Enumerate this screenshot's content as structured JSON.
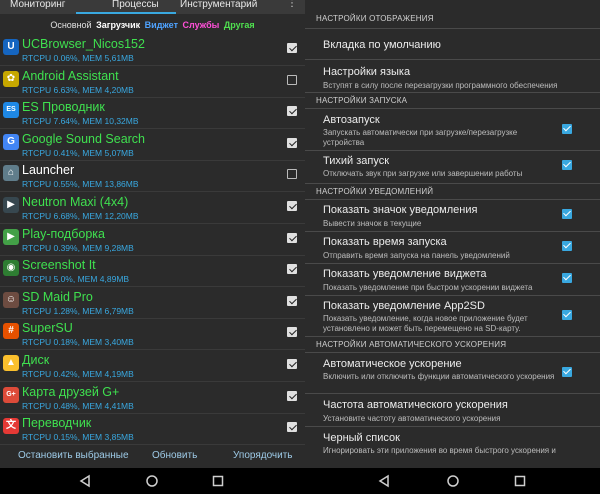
{
  "left": {
    "tabs": [
      "Мониторинг",
      "Процессы",
      "Инструментарий"
    ],
    "filters": [
      {
        "label": "Основной",
        "color": "#e0e0e0"
      },
      {
        "label": "Загрузчик",
        "color": "#ffffff"
      },
      {
        "label": "Виджет",
        "color": "#4fa3ff"
      },
      {
        "label": "Службы",
        "color": "#ff4fd8"
      },
      {
        "label": "Другая",
        "color": "#4fe04f"
      }
    ],
    "apps": [
      {
        "name": "UCBrowser_Nicos152",
        "stats": "RTCPU 0.06%, MEM 5,61MB",
        "checked": true,
        "icon": "ucbrowser-icon",
        "icon_bg": "#1565c0",
        "icon_glyph": "U",
        "name_color": "#3fe04f"
      },
      {
        "name": "Android Assistant",
        "stats": "RTCPU 6.63%, MEM 4,20MB",
        "checked": false,
        "icon": "android-assistant-icon",
        "icon_bg": "#c6a700",
        "icon_glyph": "✿",
        "name_color": "#3fe04f"
      },
      {
        "name": "ES Проводник",
        "stats": "RTCPU 7.64%, MEM 10,32MB",
        "checked": true,
        "icon": "es-explorer-icon",
        "icon_bg": "#1e88e5",
        "icon_glyph": "ES",
        "name_color": "#3fe04f"
      },
      {
        "name": "Google Sound Search",
        "stats": "RTCPU 0.41%, MEM 5,07MB",
        "checked": true,
        "icon": "google-sound-search-icon",
        "icon_bg": "#4285f4",
        "icon_glyph": "G",
        "name_color": "#3fe04f"
      },
      {
        "name": "Launcher",
        "stats": "RTCPU 0.55%, MEM 13,86MB",
        "checked": false,
        "icon": "launcher-icon",
        "icon_bg": "#607d8b",
        "icon_glyph": "⌂",
        "name_color": "#ffffff"
      },
      {
        "name": "Neutron Maxi (4x4)",
        "stats": "RTCPU 6.68%, MEM 12,20MB",
        "checked": true,
        "icon": "neutron-icon",
        "icon_bg": "#37474f",
        "icon_glyph": "▶",
        "name_color": "#3fe04f"
      },
      {
        "name": "Play-подборка",
        "stats": "RTCPU 0.39%, MEM 9,28MB",
        "checked": true,
        "icon": "play-icon",
        "icon_bg": "#43a047",
        "icon_glyph": "▶",
        "name_color": "#3fe04f"
      },
      {
        "name": "Screenshot It",
        "stats": "RTCPU 5.0%, MEM 4,89MB",
        "checked": true,
        "icon": "screenshot-icon",
        "icon_bg": "#2e7d32",
        "icon_glyph": "◉",
        "name_color": "#3fe04f"
      },
      {
        "name": "SD Maid Pro",
        "stats": "RTCPU 1.28%, MEM 6,79MB",
        "checked": true,
        "icon": "sd-maid-icon",
        "icon_bg": "#6d4c41",
        "icon_glyph": "☺",
        "name_color": "#3fe04f"
      },
      {
        "name": "SuperSU",
        "stats": "RTCPU 0.18%, MEM 3,40MB",
        "checked": true,
        "icon": "supersu-icon",
        "icon_bg": "#e65100",
        "icon_glyph": "#",
        "name_color": "#3fe04f"
      },
      {
        "name": "Диск",
        "stats": "RTCPU 0.42%, MEM 4,19MB",
        "checked": true,
        "icon": "drive-icon",
        "icon_bg": "#fbc02d",
        "icon_glyph": "▲",
        "name_color": "#3fe04f"
      },
      {
        "name": "Карта друзей G+",
        "stats": "RTCPU 0.48%, MEM 4,41MB",
        "checked": true,
        "icon": "google-plus-icon",
        "icon_bg": "#dd4b39",
        "icon_glyph": "G+",
        "name_color": "#3fe04f"
      },
      {
        "name": "Переводчик",
        "stats": "RTCPU 0.15%, MEM 3,85MB",
        "checked": true,
        "icon": "translate-icon",
        "icon_bg": "#e53935",
        "icon_glyph": "文",
        "name_color": "#3fe04f"
      }
    ],
    "bottom": {
      "stop_label": "Остановить выбранные",
      "refresh_label": "Обновить",
      "sort_label": "Упорядочить"
    }
  },
  "right": {
    "sections": {
      "display": "НАСТРОЙКИ ОТОБРАЖЕНИЯ",
      "launch": "НАСТРОЙКИ ЗАПУСКА",
      "notify": "НАСТРОЙКИ УВЕДОМЛЕНИЙ",
      "accel": "НАСТРОЙКИ АВТОМАТИЧЕСКОГО УСКОРЕНИЯ"
    },
    "default_tab": {
      "title": "Вкладка по умолчанию"
    },
    "language": {
      "title": "Настройки языка",
      "sub": "Вступят в силу после перезагрузки программного обеспечения"
    },
    "autostart": {
      "title": "Автозапуск",
      "sub": "Запускать автоматически при загрузке/перезагрузке устройства",
      "checked": true
    },
    "quiet": {
      "title": "Тихий запуск",
      "sub": "Отключать звук при загрузке или завершении работы",
      "checked": true
    },
    "notif_icon": {
      "title": "Показать значок уведомления",
      "sub": "Вывести значок в текущие",
      "checked": true
    },
    "launch_time": {
      "title": "Показать время запуска",
      "sub": "Отправить время запуска на панель уведомлений",
      "checked": true
    },
    "widget_notif": {
      "title": "Показать уведомление виджета",
      "sub": "Показать уведомление при быстром ускорении виджета",
      "checked": true
    },
    "app2sd": {
      "title": "Показать уведомление App2SD",
      "sub": "Показать уведомление, когда новое приложение будет установлено и может быть перемещено на SD-карту.",
      "checked": true
    },
    "auto_accel": {
      "title": "Автоматическое ускорение",
      "sub": "Включить или отключить функции автоматического ускорения",
      "checked": true
    },
    "accel_freq": {
      "title": "Частота автоматического ускорения",
      "sub": "Установите частоту автоматического ускорения"
    },
    "blacklist": {
      "title": "Черный список",
      "sub": "Игнорировать эти приложения во время быстрого ускорения и"
    }
  },
  "nav": {
    "back": "back-icon",
    "home": "home-icon",
    "recent": "recent-apps-icon"
  }
}
